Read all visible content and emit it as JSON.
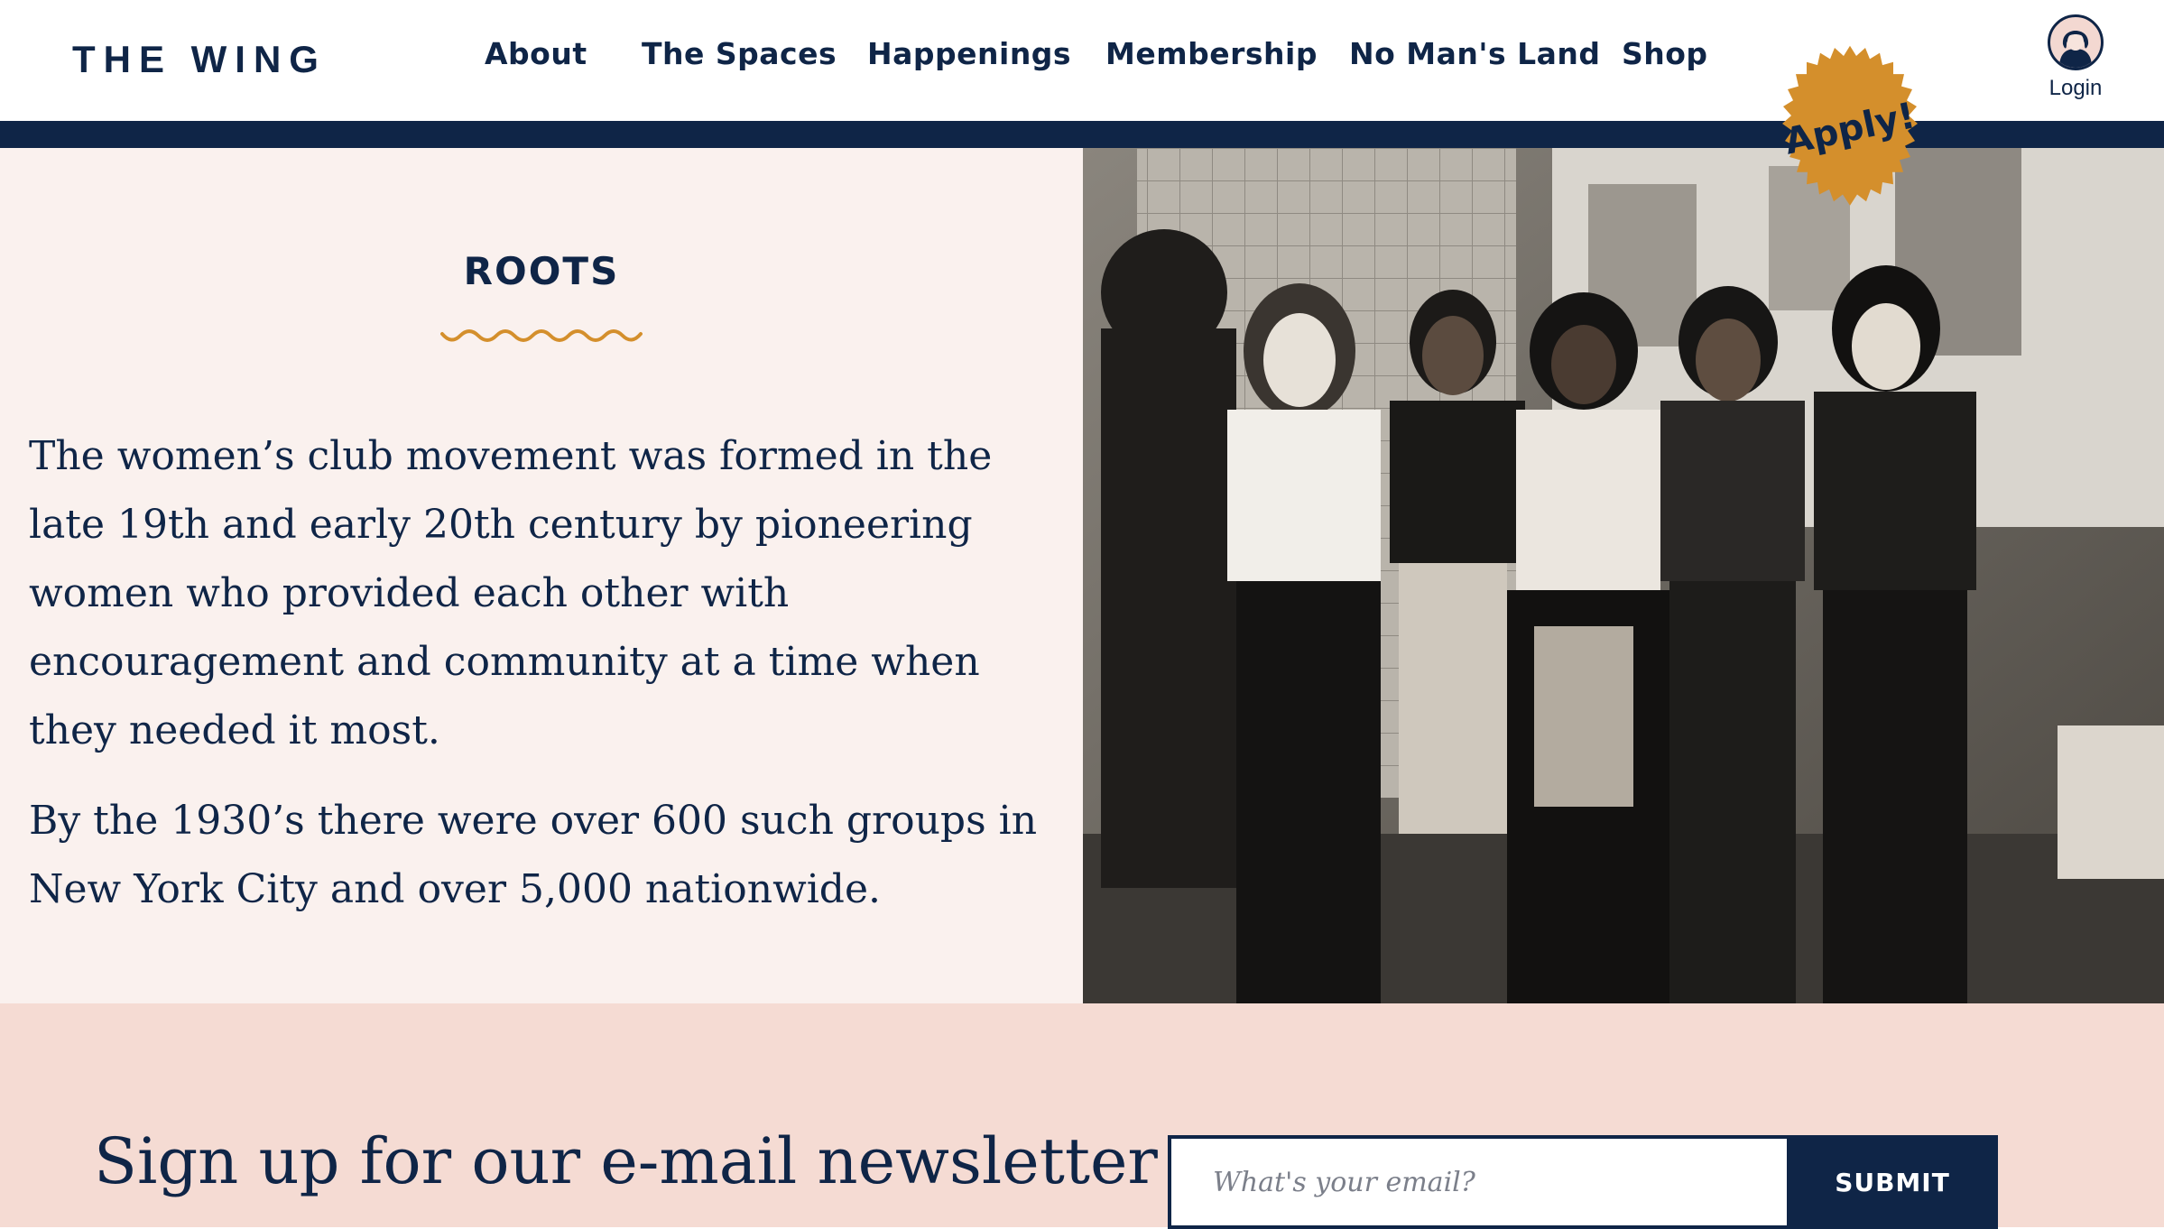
{
  "header": {
    "logo": "THE WING",
    "nav": [
      {
        "label": "About"
      },
      {
        "label": "The Spaces"
      },
      {
        "label": "Happenings"
      },
      {
        "label": "Membership"
      },
      {
        "label": "No Man's Land"
      },
      {
        "label": "Shop"
      }
    ],
    "login_label": "Login",
    "apply_label": "Apply!"
  },
  "roots": {
    "title": "ROOTS",
    "paragraphs": [
      "The women’s club movement was formed in the late 19th and early 20th century by pioneering women who provided each other with encouragement and community at a time when they needed it most.",
      "By the 1930’s there were over 600 such groups in New York City and over 5,000 nationwide."
    ]
  },
  "newsletter": {
    "title": "Sign up for our e-mail newsletter",
    "email_placeholder": "What's your email?",
    "submit_label": "SUBMIT"
  },
  "colors": {
    "navy": "#0f2547",
    "gold": "#d48f2c",
    "cream": "#faf1ee",
    "blush": "#f5dbd3"
  },
  "icons": [
    "user-avatar-icon",
    "squiggle-divider-icon",
    "apply-starburst-icon"
  ]
}
